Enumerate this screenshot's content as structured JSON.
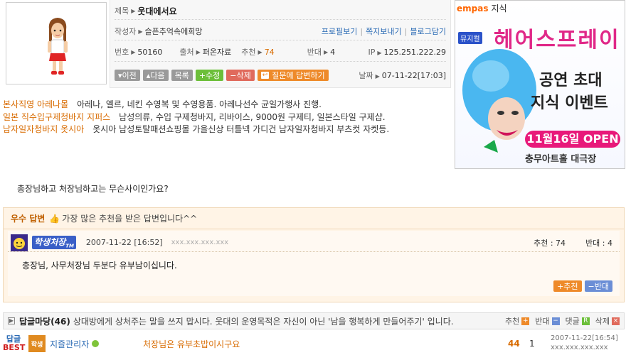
{
  "post": {
    "title_label": "제목",
    "title": "웃대에서요",
    "author_label": "작성자",
    "author": "슬픈추억속에희망",
    "links": [
      "프로필보기",
      "쪽지보내기",
      "블로그담기"
    ],
    "no_label": "번호",
    "no": "50160",
    "source_label": "출처",
    "source": "퍼온자료",
    "recommend_label": "추천",
    "recommend": "74",
    "oppose_label": "반대",
    "oppose": "4",
    "ip_label": "IP",
    "ip": "125.251.222.29",
    "date_label": "날짜",
    "date": "07-11-22[17:03]"
  },
  "buttons": {
    "prev": "이전",
    "next": "다음",
    "list": "목록",
    "edit": "수정",
    "delete": "삭제",
    "answer": "질문에 답변하기"
  },
  "sponsors": [
    {
      "keyword": "본사직영 아레나몰",
      "desc": "아레나, 엘르, 네킨 수영복 및 수영용품. 아레나선수 균일가행사 진행."
    },
    {
      "keyword": "일본 직수입구제청바지 지퍼스",
      "desc": "남성의류, 수입 구제청바지, 리바이스, 9000원 구제티, 일본스타일 구제샵."
    },
    {
      "keyword": "남자일자청바지 옷시아",
      "desc": "옷시아 남성토탈패션쇼핑몰 가을신상 터틀넥 가디건 남자일자청바지 부츠컷 자켓등."
    }
  ],
  "question": "총장님하고 처장님하고는 무슨사이인가요?",
  "best_answer": {
    "header_title": "우수 답변",
    "header_sub": "가장 많은 추천을 받은 답변입니다^^",
    "user": "학생처장",
    "user_badge": "TM",
    "time": "2007-11-22 [16:52]",
    "ip": "xxx.xxx.xxx.xxx",
    "recommend": "추천 : 74",
    "oppose": "반대 : 4",
    "body": "총장님, 사무처장님 두분다 유부남이십니다.",
    "btn_recommend": "추천",
    "btn_oppose": "반대"
  },
  "reply_bar": {
    "title": "답글마당(46)",
    "notice": "상대방에게 상처주는 말을 쓰지 맙시다. 웃대의 운영목적은 자신이 아닌 '남을 행복하게 만들어주기' 입니다.",
    "recommend": "추천",
    "oppose": "반대",
    "comment": "댓글",
    "delete": "삭제"
  },
  "reply": {
    "tag_top": "답글",
    "tag_bottom": "BEST",
    "avatar_text": "학생",
    "name": "지즐관리자",
    "text": "처장님은 유부초밥이시구요",
    "recommend": "44",
    "oppose": "1",
    "date": "2007-11-22[16:54]",
    "ip": "xxx.xxx.xxx.xxx"
  },
  "ad": {
    "brand": "empas",
    "brand_sub": "지식",
    "tag": "뮤지컬",
    "title": "헤어스프레이",
    "line1": "공연 초대",
    "line2": "지식 이벤트",
    "date": "11월16일 OPEN",
    "venue": "충무아트홀 대극장"
  }
}
